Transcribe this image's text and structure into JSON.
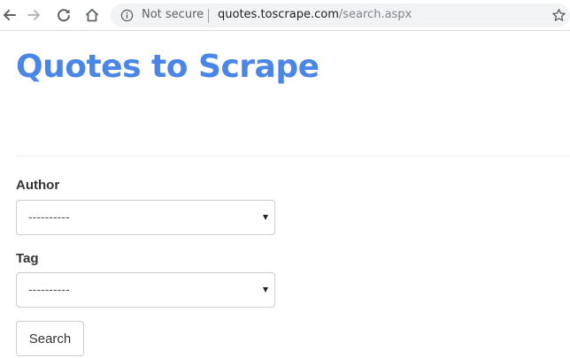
{
  "browser": {
    "icons": {
      "back": "arrow-left-icon",
      "forward": "arrow-right-icon",
      "reload": "reload-icon",
      "home": "home-icon",
      "info": "info-icon",
      "bookmark": "star-icon"
    },
    "security_text": "Not secure",
    "url_host": "quotes.toscrape.com",
    "url_path": "/search.aspx"
  },
  "page": {
    "title": "Quotes to Scrape",
    "title_color": "#4a86e8"
  },
  "form": {
    "author_label": "Author",
    "author_selected": "----------",
    "tag_label": "Tag",
    "tag_selected": "----------",
    "search_button": "Search"
  }
}
